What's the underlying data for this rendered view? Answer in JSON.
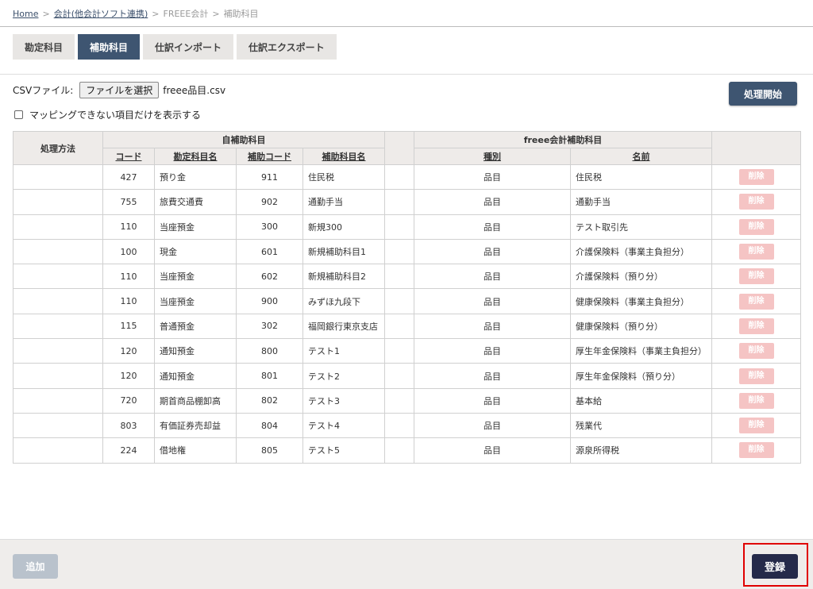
{
  "breadcrumb": {
    "home": "Home",
    "parent": "会計(他会計ソフト連携)",
    "section": "FREEE会計",
    "current": "補助科目",
    "separator": ">"
  },
  "tabs": [
    {
      "label": "勘定科目",
      "active": false
    },
    {
      "label": "補助科目",
      "active": true
    },
    {
      "label": "仕訳インポート",
      "active": false
    },
    {
      "label": "仕訳エクスポート",
      "active": false
    }
  ],
  "file_input": {
    "label": "CSVファイル:",
    "button": "ファイルを選択",
    "filename": "freee品目.csv"
  },
  "filter": {
    "label": "マッピングできない項目だけを表示する",
    "checked": false
  },
  "start_button": "処理開始",
  "table": {
    "col_method": "処理方法",
    "group_own": "自補助科目",
    "group_freee": "freee会計補助科目",
    "col_code": "コード",
    "col_account_name": "勘定科目名",
    "col_sub_code": "補助コード",
    "col_sub_name": "補助科目名",
    "col_type": "種別",
    "col_name": "名前",
    "delete_label": "削除",
    "rows": [
      {
        "method": "",
        "code": "427",
        "account": "預り金",
        "sub_code": "911",
        "sub_name": "住民税",
        "type": "品目",
        "name": "住民税"
      },
      {
        "method": "",
        "code": "755",
        "account": "旅費交通費",
        "sub_code": "902",
        "sub_name": "通勤手当",
        "type": "品目",
        "name": "通勤手当"
      },
      {
        "method": "",
        "code": "110",
        "account": "当座預金",
        "sub_code": "300",
        "sub_name": "新規300",
        "type": "品目",
        "name": "テスト取引先"
      },
      {
        "method": "",
        "code": "100",
        "account": "現金",
        "sub_code": "601",
        "sub_name": "新規補助科目1",
        "type": "品目",
        "name": "介護保険料（事業主負担分）"
      },
      {
        "method": "",
        "code": "110",
        "account": "当座預金",
        "sub_code": "602",
        "sub_name": "新規補助科目2",
        "type": "品目",
        "name": "介護保険料（預り分）"
      },
      {
        "method": "",
        "code": "110",
        "account": "当座預金",
        "sub_code": "900",
        "sub_name": "みずほ九段下",
        "type": "品目",
        "name": "健康保険料（事業主負担分）"
      },
      {
        "method": "",
        "code": "115",
        "account": "普通預金",
        "sub_code": "302",
        "sub_name": "福岡銀行東京支店",
        "type": "品目",
        "name": "健康保険料（預り分）"
      },
      {
        "method": "",
        "code": "120",
        "account": "通知預金",
        "sub_code": "800",
        "sub_name": "テスト1",
        "type": "品目",
        "name": "厚生年金保険料（事業主負担分）"
      },
      {
        "method": "",
        "code": "120",
        "account": "通知預金",
        "sub_code": "801",
        "sub_name": "テスト2",
        "type": "品目",
        "name": "厚生年金保険料（預り分）"
      },
      {
        "method": "",
        "code": "720",
        "account": "期首商品棚卸高",
        "sub_code": "802",
        "sub_name": "テスト3",
        "type": "品目",
        "name": "基本給"
      },
      {
        "method": "",
        "code": "803",
        "account": "有価証券売却益",
        "sub_code": "804",
        "sub_name": "テスト4",
        "type": "品目",
        "name": "残業代"
      },
      {
        "method": "",
        "code": "224",
        "account": "借地権",
        "sub_code": "805",
        "sub_name": "テスト5",
        "type": "品目",
        "name": "源泉所得税"
      }
    ]
  },
  "footer": {
    "add_button": "追加",
    "register_button": "登録"
  },
  "colors": {
    "primary": "#3e5571",
    "register": "#252a4a",
    "delete_disabled": "#f5c4c4",
    "add_disabled": "#b9c2cc",
    "highlight": "#e00000"
  }
}
